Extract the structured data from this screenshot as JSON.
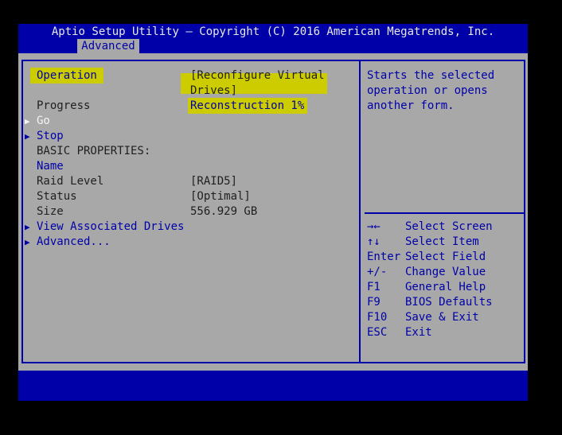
{
  "header": {
    "title": "Aptio Setup Utility – Copyright (C) 2016 American Megatrends, Inc.",
    "tab": "Advanced"
  },
  "settings": {
    "operation_label": "Operation",
    "operation_value_line1": "[Reconfigure Virtual",
    "operation_value_line2": "Drives]",
    "progress_label": "Progress",
    "progress_value": "Reconstruction 1%",
    "go": "Go",
    "stop": "Stop",
    "basic_properties": "BASIC PROPERTIES:",
    "name": "Name",
    "raid_level_label": "Raid Level",
    "raid_level_value": "[RAID5]",
    "status_label": "Status",
    "status_value": "[Optimal]",
    "size_label": "Size",
    "size_value": "556.929 GB",
    "view_associated_drives": "View Associated Drives",
    "advanced": "Advanced..."
  },
  "help": {
    "lines": [
      "Starts the selected",
      "operation or opens",
      "another form."
    ]
  },
  "keys": [
    {
      "key": "→←",
      "desc": "Select Screen"
    },
    {
      "key": "↑↓",
      "desc": "Select Item"
    },
    {
      "key": "Enter",
      "desc": "Select Field"
    },
    {
      "key": "+/-",
      "desc": "Change Value"
    },
    {
      "key": "F1",
      "desc": "General Help"
    },
    {
      "key": "F9",
      "desc": "BIOS Defaults"
    },
    {
      "key": "F10",
      "desc": "Save & Exit"
    },
    {
      "key": "ESC",
      "desc": "Exit"
    }
  ],
  "colors": {
    "bios_blue": "#0000a8",
    "bios_gray": "#a8a8a8",
    "highlight": "#cccc00"
  }
}
